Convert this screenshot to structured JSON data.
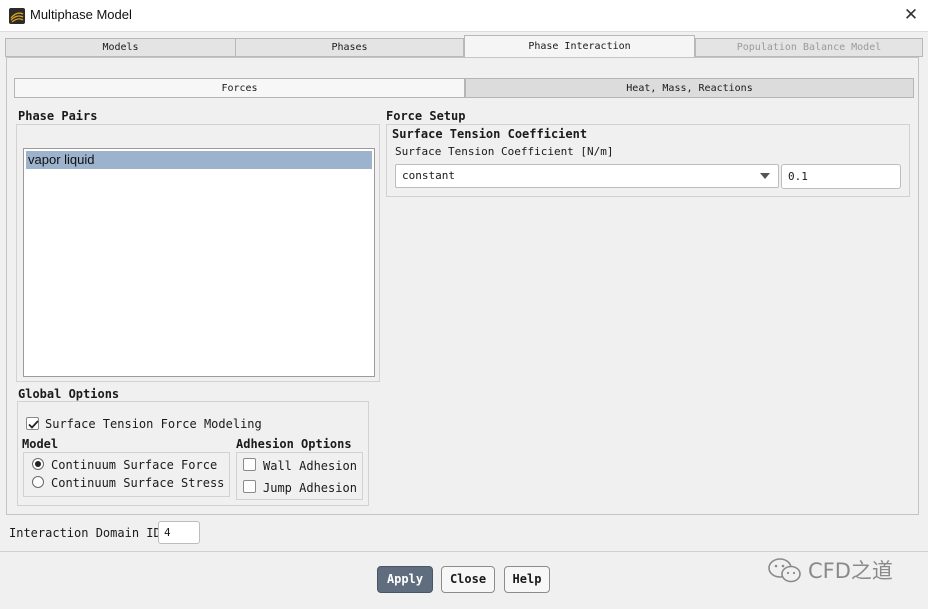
{
  "window": {
    "title": "Multiphase Model",
    "close_glyph": "✕"
  },
  "tabs": [
    {
      "label": "Models"
    },
    {
      "label": "Phases"
    },
    {
      "label": "Phase Interaction"
    },
    {
      "label": "Population Balance Model"
    }
  ],
  "subtabs": [
    {
      "label": "Forces"
    },
    {
      "label": "Heat, Mass, Reactions"
    }
  ],
  "phase_pairs": {
    "title": "Phase Pairs",
    "items": [
      "vapor liquid"
    ]
  },
  "force_setup": {
    "title": "Force Setup",
    "group_title": "Surface Tension Coefficient",
    "field_label": "Surface Tension Coefficient [N/m]",
    "method": "constant",
    "value": "0.1"
  },
  "global_options": {
    "title": "Global Options",
    "surface_tension_modeling": {
      "label": "Surface Tension Force Modeling",
      "checked": true
    },
    "model": {
      "title": "Model",
      "options": [
        {
          "label": "Continuum Surface Force",
          "selected": true
        },
        {
          "label": "Continuum Surface Stress",
          "selected": false
        }
      ]
    },
    "adhesion": {
      "title": "Adhesion Options",
      "options": [
        {
          "label": "Wall Adhesion",
          "checked": false
        },
        {
          "label": "Jump Adhesion",
          "checked": false
        }
      ]
    }
  },
  "interaction_domain": {
    "label": "Interaction Domain ID",
    "value": "4"
  },
  "buttons": {
    "apply": "Apply",
    "close": "Close",
    "help": "Help"
  },
  "watermark": {
    "text": "CFD之道"
  },
  "colors": {
    "selection": "#9db3cd",
    "primary_button": "#5f6d7f"
  }
}
